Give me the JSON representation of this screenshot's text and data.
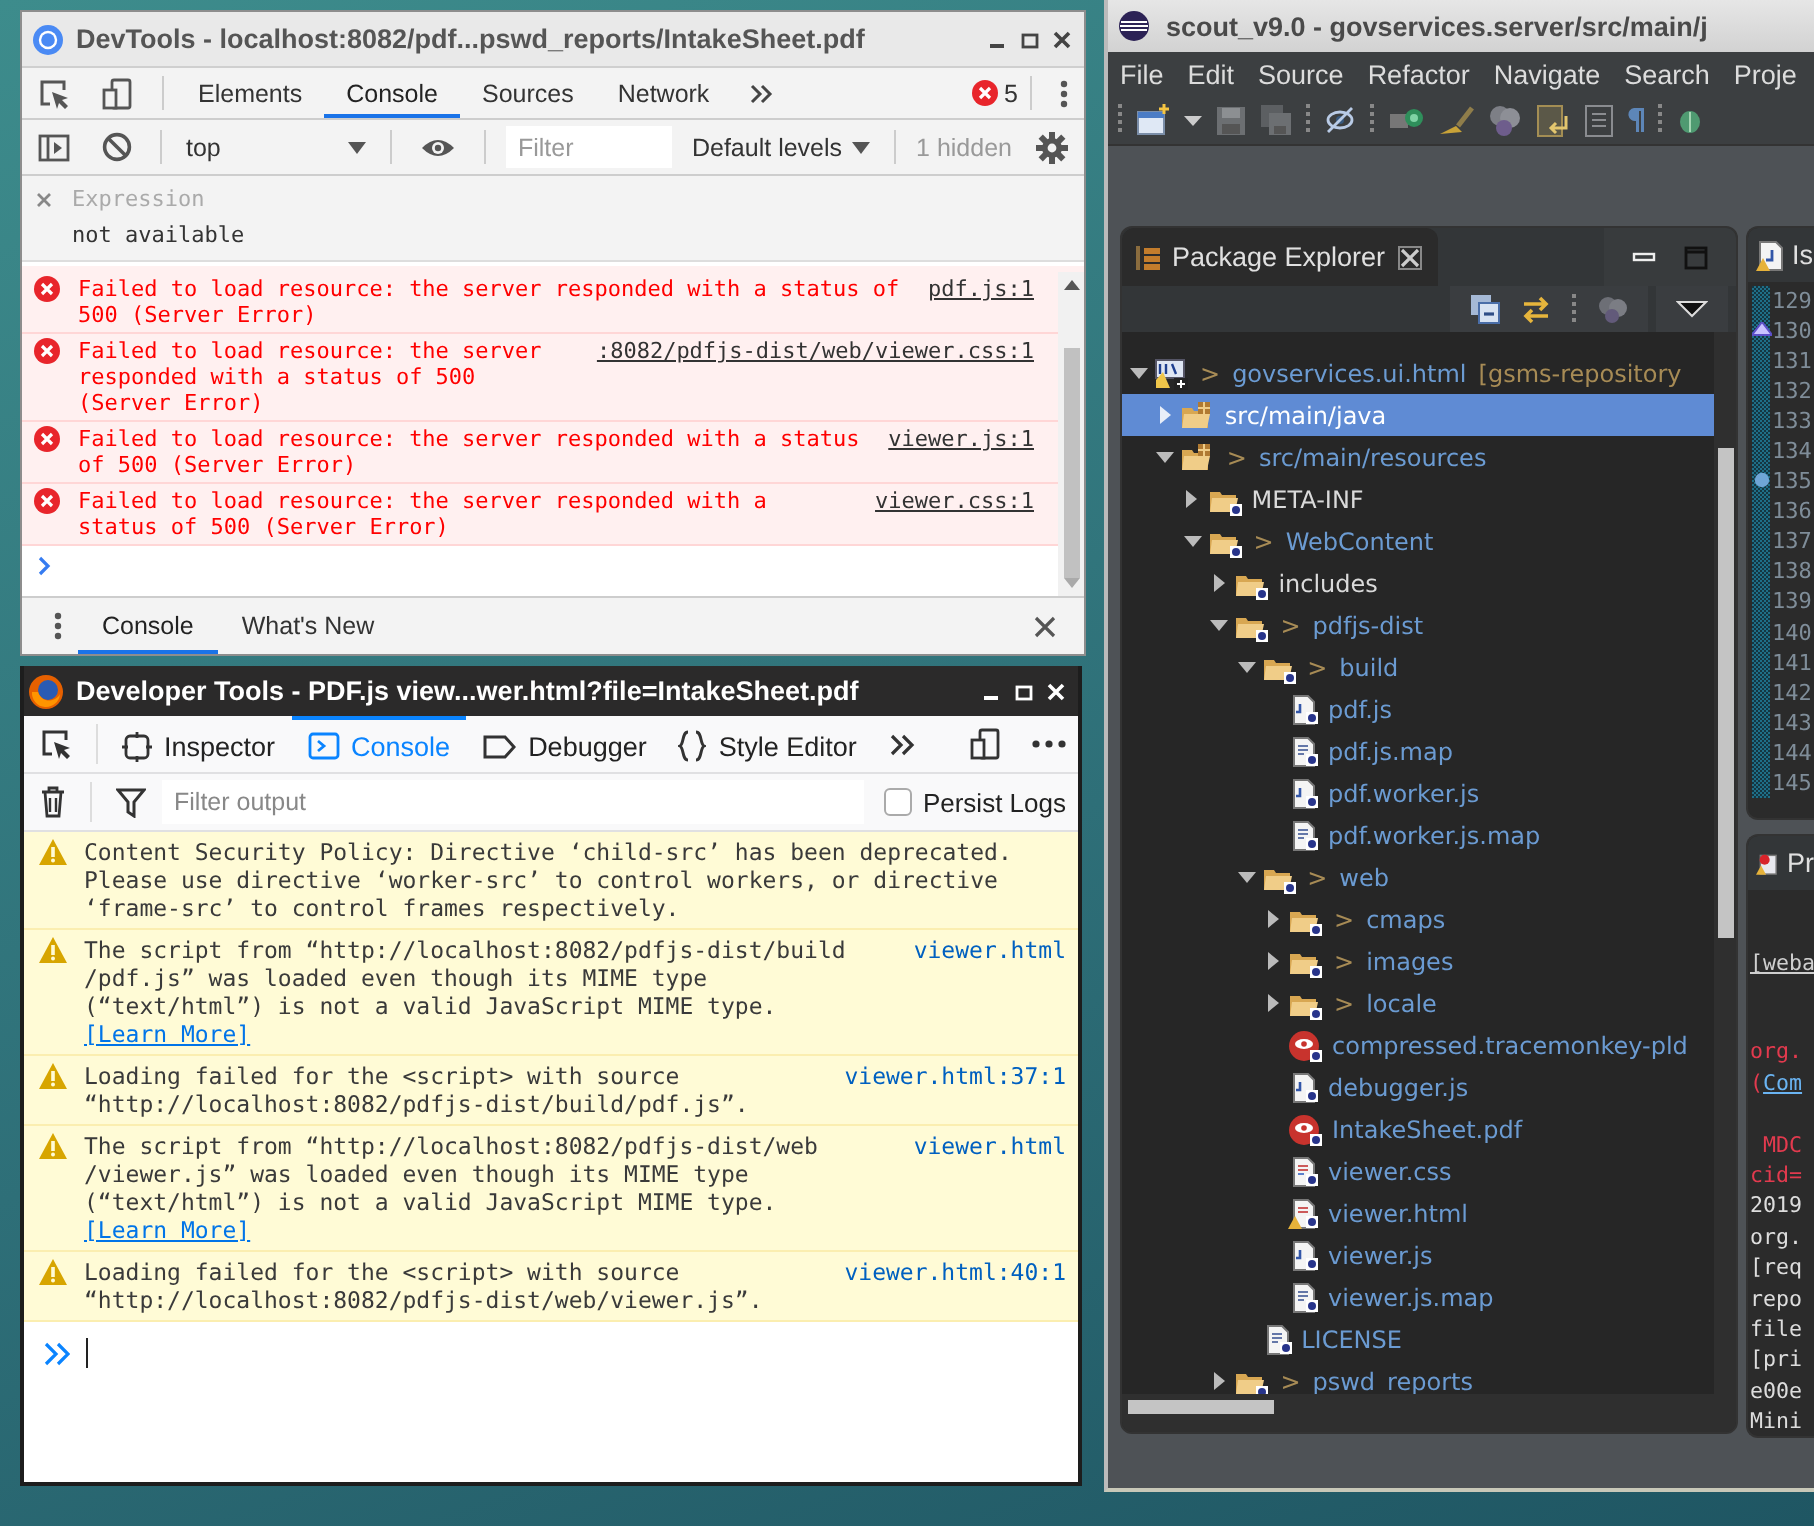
{
  "chrome_devtools": {
    "title": "DevTools - localhost:8082/pdf...pswd_reports/IntakeSheet.pdf",
    "tabs": [
      {
        "label": "Elements",
        "selected": false
      },
      {
        "label": "Console",
        "selected": true
      },
      {
        "label": "Sources",
        "selected": false
      },
      {
        "label": "Network",
        "selected": false
      }
    ],
    "error_count": "5",
    "context": "top",
    "filter": {
      "placeholder": "Filter"
    },
    "levels": "Default levels",
    "hidden_count": "1 hidden",
    "expression": {
      "placeholder": "Expression",
      "value": "not available"
    },
    "messages": [
      {
        "text": "Failed to load resource: the server responded with a status of 500 (Server Error)",
        "source": "pdf.js:1"
      },
      {
        "text": "Failed to load resource: the server responded with a status of 500 (Server Error)",
        "source": ":8082/pdfjs-dist/web/viewer.css:1"
      },
      {
        "text": "Failed to load resource: the server responded with a status of 500 (Server Error)",
        "source": "viewer.js:1"
      },
      {
        "text": "Failed to load resource: the server responded with a status of 500 (Server Error)",
        "source": "viewer.css:1"
      }
    ],
    "drawer_tabs": [
      {
        "label": "Console",
        "selected": true
      },
      {
        "label": "What's New",
        "selected": false
      }
    ]
  },
  "firefox_devtools": {
    "title": "Developer Tools - PDF.js view...wer.html?file=IntakeSheet.pdf",
    "tabs": [
      {
        "label": "Inspector",
        "kind": "inspector",
        "selected": false
      },
      {
        "label": "Console",
        "kind": "console",
        "selected": true
      },
      {
        "label": "Debugger",
        "kind": "debugger",
        "selected": false
      },
      {
        "label": "Style Editor",
        "kind": "style",
        "selected": false
      }
    ],
    "filter": {
      "placeholder": "Filter output"
    },
    "persist_logs": {
      "label": "Persist Logs",
      "checked": false
    },
    "messages": [
      {
        "text": "Content Security Policy: Directive ‘child-src’ has been deprecated. Please use directive ‘worker-src’ to control workers, or directive ‘frame-src’ to control frames respectively."
      },
      {
        "text": "The script from “http://localhost:8082/pdfjs-dist/build /pdf.js” was loaded even though its MIME type (“text/html”) is not a valid JavaScript MIME type.",
        "link": "[Learn More]",
        "source": "viewer.html"
      },
      {
        "text": "Loading failed for the <script> with source “http://localhost:8082/pdfjs-dist/build/pdf.js”.",
        "source": "viewer.html:37:1"
      },
      {
        "text": "The script from “http://localhost:8082/pdfjs-dist/web /viewer.js” was loaded even though its MIME type (“text/html”) is not a valid JavaScript MIME type.",
        "link": "[Learn More]",
        "source": "viewer.html"
      },
      {
        "text": "Loading failed for the <script> with source “http://localhost:8082/pdfjs-dist/web/viewer.js”.",
        "source": "viewer.html:40:1"
      }
    ]
  },
  "eclipse": {
    "title": "scout_v9.0 - govservices.server/src/main/j",
    "menu": [
      "File",
      "Edit",
      "Source",
      "Refactor",
      "Navigate",
      "Search",
      "Proje"
    ],
    "package_explorer": {
      "title": "Package Explorer",
      "tree": [
        {
          "label": "govservices.ui.html",
          "marker": ">",
          "decoration": "[gsms-repository",
          "kind": "project",
          "tracked": false,
          "selected": false,
          "expanded": true,
          "children": [
            {
              "label": "src/main/java",
              "kind": "source-folder",
              "tracked": true,
              "selected": true,
              "expanded": false
            },
            {
              "label": "src/main/resources",
              "marker": ">",
              "kind": "source-folder",
              "tracked": false,
              "selected": false,
              "expanded": true,
              "children": [
                {
                  "label": "META-INF",
                  "kind": "folder",
                  "tracked": true,
                  "selected": false,
                  "expanded": false
                },
                {
                  "label": "WebContent",
                  "marker": ">",
                  "kind": "folder",
                  "tracked": false,
                  "selected": false,
                  "expanded": true,
                  "children": [
                    {
                      "label": "includes",
                      "kind": "folder",
                      "tracked": true,
                      "selected": false,
                      "expanded": false
                    },
                    {
                      "label": "pdfjs-dist",
                      "marker": ">",
                      "kind": "folder",
                      "tracked": false,
                      "selected": false,
                      "expanded": true,
                      "children": [
                        {
                          "label": "build",
                          "marker": ">",
                          "kind": "folder",
                          "tracked": false,
                          "selected": false,
                          "expanded": true,
                          "children": [
                            {
                              "label": "pdf.js",
                              "kind": "js-file",
                              "tracked": false,
                              "selected": false
                            },
                            {
                              "label": "pdf.js.map",
                              "kind": "text-file",
                              "tracked": false,
                              "selected": false
                            },
                            {
                              "label": "pdf.worker.js",
                              "kind": "js-file",
                              "tracked": false,
                              "selected": false
                            },
                            {
                              "label": "pdf.worker.js.map",
                              "kind": "text-file",
                              "tracked": false,
                              "selected": false
                            }
                          ]
                        },
                        {
                          "label": "web",
                          "marker": ">",
                          "kind": "folder",
                          "tracked": false,
                          "selected": false,
                          "expanded": true,
                          "children": [
                            {
                              "label": "cmaps",
                              "marker": ">",
                              "kind": "folder",
                              "tracked": false,
                              "selected": false,
                              "expanded": false
                            },
                            {
                              "label": "images",
                              "marker": ">",
                              "kind": "folder",
                              "tracked": false,
                              "selected": false,
                              "expanded": false
                            },
                            {
                              "label": "locale",
                              "marker": ">",
                              "kind": "folder",
                              "tracked": false,
                              "selected": false,
                              "expanded": false
                            },
                            {
                              "label": "compressed.tracemonkey-pld",
                              "kind": "pdf-file",
                              "tracked": false,
                              "selected": false
                            },
                            {
                              "label": "debugger.js",
                              "kind": "js-file",
                              "tracked": false,
                              "selected": false
                            },
                            {
                              "label": "IntakeSheet.pdf",
                              "kind": "pdf-file",
                              "tracked": false,
                              "selected": false
                            },
                            {
                              "label": "viewer.css",
                              "kind": "css-file",
                              "tracked": false,
                              "selected": false
                            },
                            {
                              "label": "viewer.html",
                              "kind": "html-file",
                              "tracked": false,
                              "selected": false
                            },
                            {
                              "label": "viewer.js",
                              "kind": "js-file",
                              "tracked": false,
                              "selected": false
                            },
                            {
                              "label": "viewer.js.map",
                              "kind": "text-file",
                              "tracked": false,
                              "selected": false
                            }
                          ]
                        },
                        {
                          "label": "LICENSE",
                          "kind": "text-file",
                          "tracked": false,
                          "selected": false
                        }
                      ]
                    },
                    {
                      "label": "pswd_reports",
                      "marker": ">",
                      "kind": "folder",
                      "tracked": false,
                      "selected": false,
                      "expanded": false
                    }
                  ]
                }
              ]
            }
          ]
        }
      ]
    },
    "editor_tab": "Is",
    "line_numbers": [
      {
        "number": "129",
        "kind": "plain"
      },
      {
        "number": "130",
        "kind": "task"
      },
      {
        "number": "131",
        "kind": "plain"
      },
      {
        "number": "132",
        "kind": "plain"
      },
      {
        "number": "133",
        "kind": "plain"
      },
      {
        "number": "134",
        "kind": "plain"
      },
      {
        "number": "135",
        "kind": "breakpoint"
      },
      {
        "number": "136",
        "kind": "plain"
      },
      {
        "number": "137",
        "kind": "plain"
      },
      {
        "number": "138",
        "kind": "plain"
      },
      {
        "number": "139",
        "kind": "plain"
      },
      {
        "number": "140",
        "kind": "plain"
      },
      {
        "number": "141",
        "kind": "plain"
      },
      {
        "number": "142",
        "kind": "plain"
      },
      {
        "number": "143",
        "kind": "plain"
      },
      {
        "number": "144",
        "kind": "plain"
      },
      {
        "number": "145",
        "kind": "plain"
      }
    ],
    "console_tab": "Pr",
    "console_description": "[weba",
    "console_lines": [
      {
        "segments": [
          {
            "text": "org.",
            "kind": "error"
          }
        ]
      },
      {
        "segments": [
          {
            "text": "(",
            "kind": "error"
          },
          {
            "text": "Com",
            "kind": "link"
          }
        ]
      },
      {
        "blank_before": true,
        "segments": [
          {
            "text": " MDC",
            "kind": "error"
          }
        ]
      },
      {
        "segments": [
          {
            "text": "cid=",
            "kind": "error"
          }
        ]
      },
      {
        "segments": [
          {
            "text": "2019",
            "kind": "plain"
          }
        ]
      },
      {
        "segments": [
          {
            "text": "org.",
            "kind": "plain"
          }
        ]
      },
      {
        "segments": [
          {
            "text": "[req",
            "kind": "plain"
          }
        ]
      },
      {
        "segments": [
          {
            "text": "repo",
            "kind": "plain"
          }
        ]
      },
      {
        "segments": [
          {
            "text": "file",
            "kind": "plain"
          }
        ]
      },
      {
        "segments": [
          {
            "text": "[pri",
            "kind": "plain"
          }
        ]
      },
      {
        "segments": [
          {
            "text": "e00e",
            "kind": "plain"
          }
        ]
      },
      {
        "segments": [
          {
            "text": "Mini",
            "kind": "plain"
          }
        ]
      }
    ]
  }
}
